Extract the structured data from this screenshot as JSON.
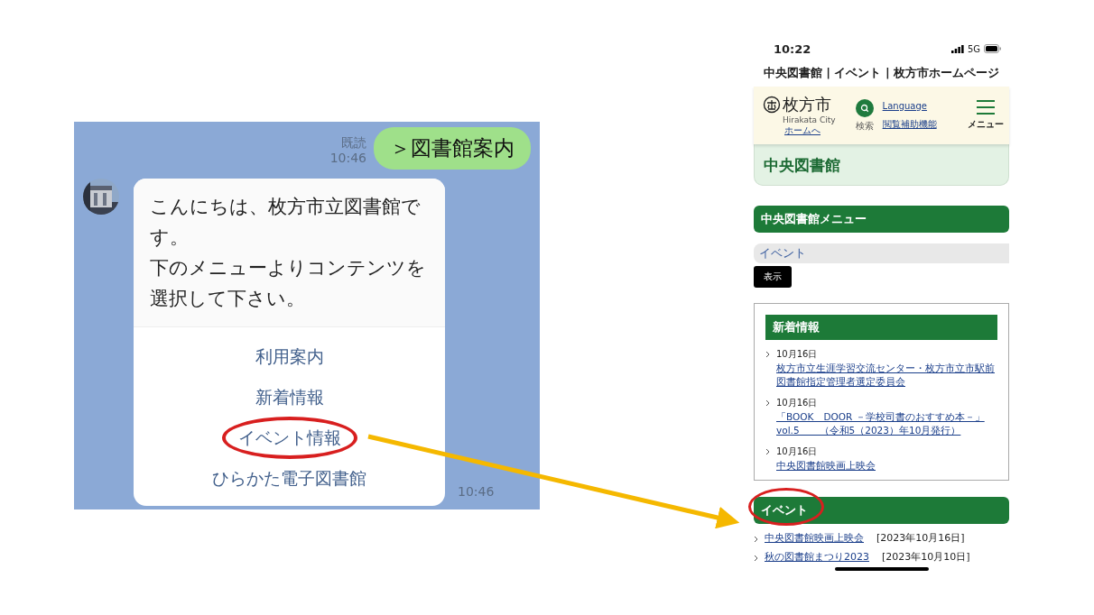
{
  "chat": {
    "read_label": "既読",
    "sent_time": "10:46",
    "sent_message": "＞図書館案内",
    "reply": {
      "paragraphs": [
        "こんにちは、枚方市立図書館です。",
        "下のメニューよりコンテンツを選択して下さい。"
      ],
      "menu": [
        {
          "label": "利用案内",
          "circled": false
        },
        {
          "label": "新着情報",
          "circled": false
        },
        {
          "label": "イベント情報",
          "circled": true
        },
        {
          "label": "ひらかた電子図書館",
          "circled": false
        }
      ],
      "time": "10:46"
    }
  },
  "phone": {
    "status": {
      "time": "10:22",
      "network": "5G"
    },
    "page_title": "中央図書館 | イベント | 枚方市ホームページ",
    "header": {
      "logo": "枚方市",
      "logo_sub": "Hirakata City",
      "home_link": "ホームへ",
      "search_label": "検索",
      "language_link": "Language",
      "accessibility_link": "閲覧補助機能",
      "menu_label": "メニュー"
    },
    "page_heading": "中央図書館",
    "section_menu": {
      "title": "中央図書館メニュー",
      "select_value": "イベント",
      "button": "表示"
    },
    "news": {
      "title": "新着情報",
      "items": [
        {
          "date": "10月16日",
          "link": "枚方市立生涯学習交流センター・枚方市立市駅前図書館指定管理者選定委員会"
        },
        {
          "date": "10月16日",
          "link": "「BOOK　DOOR －学校司書のおすすめ本－」 vol.5　　（令和5（2023）年10月発行）"
        },
        {
          "date": "10月16日",
          "link": "中央図書館映画上映会"
        }
      ]
    },
    "events": {
      "title": "イベント",
      "circled": true,
      "items": [
        {
          "link": "中央図書館映画上映会",
          "date": "[2023年10月16日]"
        },
        {
          "link": "秋の図書館まつり2023",
          "date": "[2023年10月10日]"
        }
      ]
    }
  }
}
